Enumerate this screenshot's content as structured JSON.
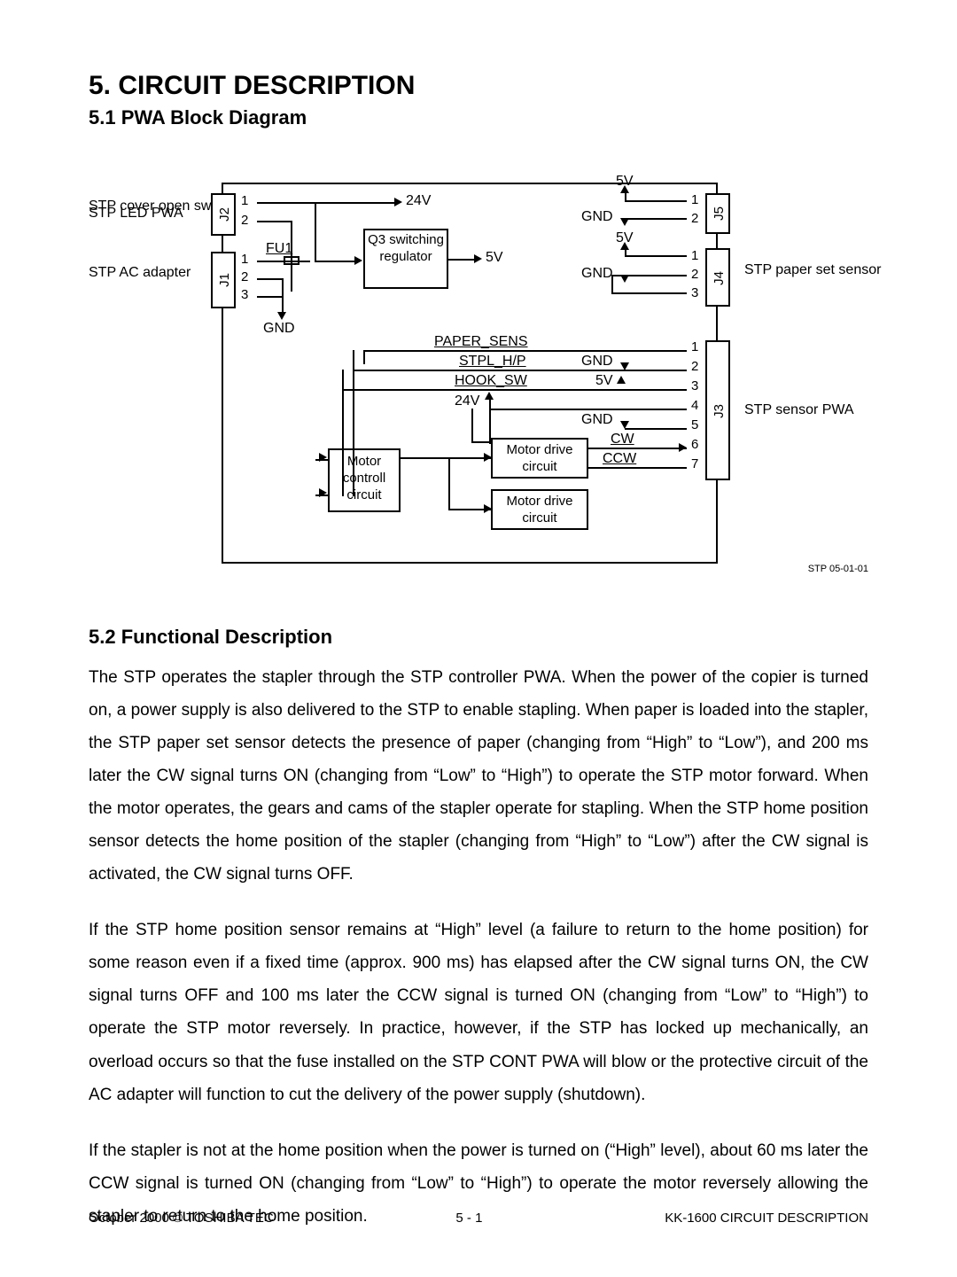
{
  "section_num_title": "5.  CIRCUIT DESCRIPTION",
  "sub_51": "5.1  PWA Block Diagram",
  "sub_52": "5.2  Functional Description",
  "diagram": {
    "left_labels": {
      "cover_open": "STP cover open switch",
      "ac_adapter": "STP AC adapter"
    },
    "right_labels": {
      "led_pwa": "STP LED PWA",
      "paper_set": "STP paper set sensor",
      "sensor_pwa": "STP sensor PWA"
    },
    "connectors": {
      "j1": "J1",
      "j2": "J2",
      "j3": "J3",
      "j4": "J4",
      "j5": "J5"
    },
    "blocks": {
      "q3": "Q3 switching regulator",
      "motor_ctrl": "Motor controll circuit",
      "motor_drv1": "Motor drive circuit",
      "motor_drv2": "Motor drive circuit"
    },
    "rails": {
      "v5": "5V",
      "v24": "24V",
      "gnd": "GND",
      "fu1": "FU1"
    },
    "signals": {
      "paper_sens": "PAPER_SENS",
      "stpl_hp": "STPL_H/P",
      "hook_sw": "HOOK_SW",
      "cw": "CW",
      "ccw": "CCW"
    },
    "pins": [
      "1",
      "2",
      "3",
      "4",
      "5",
      "6",
      "7"
    ],
    "fig_ref": "STP 05-01-01"
  },
  "paras": {
    "p1": "The STP operates the stapler through the STP controller PWA.  When the power of the copier is turned on, a power supply is also delivered to the STP to enable stapling.  When paper is loaded into the stapler, the STP paper set sensor detects the presence of paper (changing from “High” to “Low”), and 200 ms later the CW signal turns ON (changing from “Low” to “High”) to operate the STP motor forward.  When the motor operates, the gears and cams of the stapler operate for stapling.  When the STP home position sensor detects the home position of the stapler (changing from “High” to “Low”) after the CW signal is activated, the CW signal turns OFF.",
    "p2": "If the STP home position sensor remains at “High” level (a failure to return to the home position) for some reason even if a fixed time (approx. 900 ms) has elapsed after the CW signal turns ON, the CW signal turns OFF and 100 ms later the CCW signal is turned ON (changing from “Low” to “High”) to operate the STP motor reversely.  In practice, however, if the STP has locked up mechanically, an overload occurs so that the fuse installed on the STP CONT PWA will blow or the protective circuit of the AC adapter will function to cut the delivery of the power supply (shutdown).",
    "p3": "If the stapler is not at the home position when the power is turned on (“High” level), about 60 ms later the CCW signal is turned ON (changing from “Low” to “High”) to operate the motor reversely allowing the stapler to return to the home position."
  },
  "footer": {
    "left": "October 2000 © TOSHIBA TEC",
    "center": "5 - 1",
    "right": "KK-1600 CIRCUIT DESCRIPTION"
  }
}
